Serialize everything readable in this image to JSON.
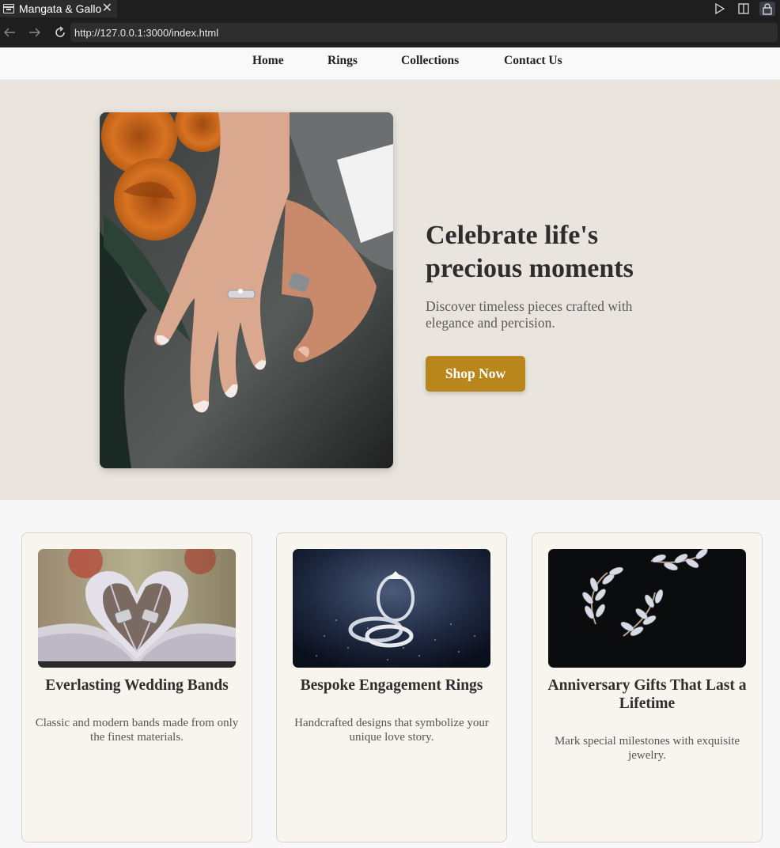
{
  "browser": {
    "tab_title": "Mangata & Gallo",
    "url": "http://127.0.0.1:3000/index.html"
  },
  "nav": {
    "items": [
      "Home",
      "Rings",
      "Collections",
      "Contact Us"
    ]
  },
  "hero": {
    "title": "Celebrate life's precious moments",
    "subtitle": "Discover timeless pieces crafted with elegance and percision.",
    "button": "Shop Now",
    "button_color": "#b8861b",
    "background": "#e9e4de"
  },
  "cards": [
    {
      "title": "Everlasting Wedding Bands",
      "description": "Classic and modern bands made from only the finest materials."
    },
    {
      "title": "Bespoke Engagement Rings",
      "description": "Handcrafted designs that symbolize your unique love story."
    },
    {
      "title": "Anniversary Gifts That Last a Lifetime",
      "description": "Mark special milestones with exquisite jewelry."
    }
  ]
}
